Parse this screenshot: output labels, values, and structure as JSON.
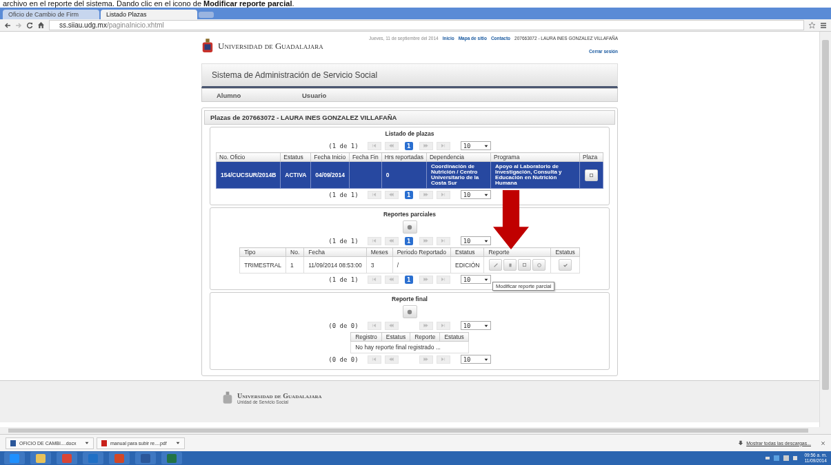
{
  "instruction": "archivo en el reporte del sistema. Dando clic en el icono de **Modificar reporte parcial**.",
  "browser": {
    "tabs": [
      {
        "label": "Oficio de Cambio de Firm",
        "selected": false
      },
      {
        "label": "Listado Plazas",
        "selected": true
      }
    ],
    "url_host": "ss.siiau.udg.mx",
    "url_path": "/paginaInicio.xhtml"
  },
  "header": {
    "logo_text": "Universidad de Guadalajara",
    "date": "Jueves, 11 de septiembre del 2014",
    "links": [
      "Inicio",
      "Mapa de sitio",
      "Contacto"
    ],
    "user": "207663072 - LAURA INES GONZALEZ VILLAFAÑA",
    "logout": "Cerrar sesión"
  },
  "system_title": "Sistema de Administración de Servicio Social",
  "nav": [
    "Alumno",
    "Usuario"
  ],
  "panel_title": "Plazas de 207663072 - LAURA INES GONZALEZ VILLAFAÑA",
  "plazas": {
    "title": "Listado de plazas",
    "pager_top": {
      "info": "(1 de 1)",
      "page": "1",
      "per_page": "10"
    },
    "pager_bottom": {
      "info": "(1 de 1)",
      "page": "1",
      "per_page": "10"
    },
    "columns": [
      "No. Oficio",
      "Estatus",
      "Fecha Inicio",
      "Fecha Fin",
      "Hrs reportadas",
      "Dependencia",
      "Programa",
      "Plaza"
    ],
    "rows": [
      {
        "selected": true,
        "cells": [
          "154/CUCSUR/2014B",
          "ACTIVA",
          "04/09/2014",
          "",
          "0",
          "Coordinación de Nutrición / Centro Universitario de la Costa Sur",
          "Apoyo al Laboratorio de Investigación, Consulta y Educación en Nutrición Humana"
        ]
      }
    ]
  },
  "parciales": {
    "title": "Reportes parciales",
    "pager_top": {
      "info": "(1 de 1)",
      "page": "1",
      "per_page": "10"
    },
    "pager_bottom": {
      "info": "(1 de 1)",
      "page": "1",
      "per_page": "10"
    },
    "columns": [
      "Tipo",
      "No.",
      "Fecha",
      "Meses",
      "Periodo Reportado",
      "Estatus",
      "Reporte",
      "Estatus"
    ],
    "rows": [
      {
        "cells": [
          "TRIMESTRAL",
          "1",
          "11/09/2014 08:53:00",
          "3",
          "/",
          "EDICIÓN"
        ]
      }
    ],
    "tooltip": "Modificar reporte parcial"
  },
  "final": {
    "title": "Reporte final",
    "pager_top": {
      "info": "(0 de 0)",
      "per_page": "10"
    },
    "pager_bottom": {
      "info": "(0 de 0)",
      "per_page": "10"
    },
    "columns": [
      "Registro",
      "Estatus",
      "Reporte",
      "Estatus"
    ],
    "empty": "No hay reporte final registrado ..."
  },
  "footer": {
    "logo_text": "Universidad de Guadalajara",
    "unit": "Unidad de Servicio Social"
  },
  "downloads": {
    "items": [
      {
        "name": "OFICIO DE CAMBI....docx",
        "kind": "word"
      },
      {
        "name": "manual para subir re....pdf",
        "kind": "pdf"
      }
    ],
    "show_all": "Mostrar todas las descargas..."
  },
  "taskbar": {
    "apps": [
      {
        "kind": "ie"
      },
      {
        "kind": "folder"
      },
      {
        "kind": "chrome"
      },
      {
        "kind": "outlook"
      },
      {
        "kind": "powerpoint"
      },
      {
        "kind": "word"
      },
      {
        "kind": "excel"
      }
    ],
    "time": "09:56 a. m.",
    "date": "11/09/2014"
  }
}
